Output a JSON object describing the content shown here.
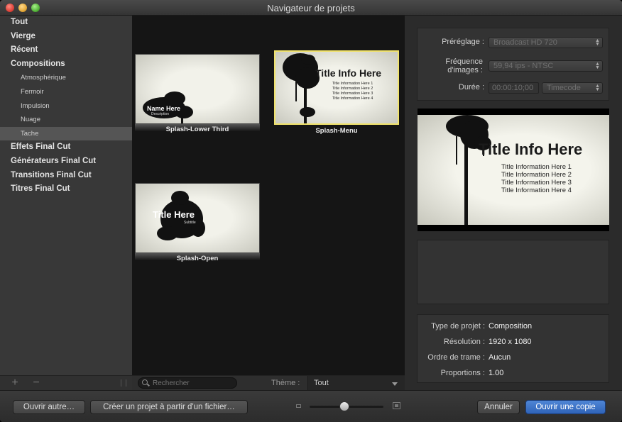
{
  "window": {
    "title": "Navigateur de projets"
  },
  "sidebar": {
    "items": [
      {
        "label": "Tout",
        "level": "category",
        "name": "sidebar-item-tout"
      },
      {
        "label": "Vierge",
        "level": "category",
        "name": "sidebar-item-vierge"
      },
      {
        "label": "Récent",
        "level": "category",
        "name": "sidebar-item-recent"
      },
      {
        "label": "Compositions",
        "level": "category",
        "name": "sidebar-item-compositions"
      },
      {
        "label": "Atmosphérique",
        "level": "sub",
        "name": "sidebar-item-atmospherique"
      },
      {
        "label": "Fermoir",
        "level": "sub",
        "name": "sidebar-item-fermoir"
      },
      {
        "label": "Impulsion",
        "level": "sub",
        "name": "sidebar-item-impulsion"
      },
      {
        "label": "Nuage",
        "level": "sub",
        "name": "sidebar-item-nuage"
      },
      {
        "label": "Tache",
        "level": "sub",
        "name": "sidebar-item-tache",
        "selected": true
      },
      {
        "label": "Effets Final Cut",
        "level": "category",
        "name": "sidebar-item-effets-final-cut"
      },
      {
        "label": "Générateurs Final Cut",
        "level": "category",
        "name": "sidebar-item-generateurs-final-cut"
      },
      {
        "label": "Transitions Final Cut",
        "level": "category",
        "name": "sidebar-item-transitions-final-cut"
      },
      {
        "label": "Titres Final Cut",
        "level": "category",
        "name": "sidebar-item-titres-final-cut"
      }
    ],
    "add_label": "+",
    "remove_label": "−"
  },
  "browser": {
    "thumbnails": [
      {
        "label": "Splash-Lower Third",
        "title_text": "Name Here",
        "subtitle_text": "Description"
      },
      {
        "label": "Splash-Menu",
        "title_text": "Title Info Here",
        "lines": [
          "Title Information Here 1",
          "Title Information Here 2",
          "Title Information Here 3",
          "Title Information Here 4"
        ],
        "selected": true
      },
      {
        "label": "Splash-Open",
        "title_text": "Title Here",
        "subtitle_text": "Subtitle"
      }
    ]
  },
  "search": {
    "placeholder": "Rechercher"
  },
  "theme": {
    "label": "Thème :",
    "value": "Tout"
  },
  "settings": {
    "preset_label": "Préréglage :",
    "preset_value": "Broadcast HD 720",
    "framerate_label_1": "Fréquence",
    "framerate_label_2": "d'images :",
    "framerate_value": "59,94 ips - NTSC",
    "duration_label": "Durée :",
    "duration_value": "00:00:10;00",
    "duration_unit": "Timecode"
  },
  "preview": {
    "title_text": "Title Info Here",
    "lines": [
      "Title Information Here 1",
      "Title Information Here 2",
      "Title Information Here 3",
      "Title Information Here 4"
    ]
  },
  "info": {
    "rows": [
      {
        "key": "Type de projet :",
        "value": "Composition"
      },
      {
        "key": "Résolution :",
        "value": "1920 x 1080"
      },
      {
        "key": "Ordre de trame :",
        "value": "Aucun"
      },
      {
        "key": "Proportions :",
        "value": "1.00"
      }
    ]
  },
  "bottom": {
    "open_other": "Ouvrir autre…",
    "create_from_file": "Créer un projet à partir d'un fichier…",
    "cancel": "Annuler",
    "open_copy": "Ouvrir une copie",
    "zoom_level": 0.47
  },
  "colors": {
    "accent": "#3d74c9",
    "selection_outline": "#f0e26a"
  },
  "icons": {
    "search": "search-icon",
    "zoom_small": "zoom-small-icon",
    "zoom_large": "zoom-large-icon"
  }
}
